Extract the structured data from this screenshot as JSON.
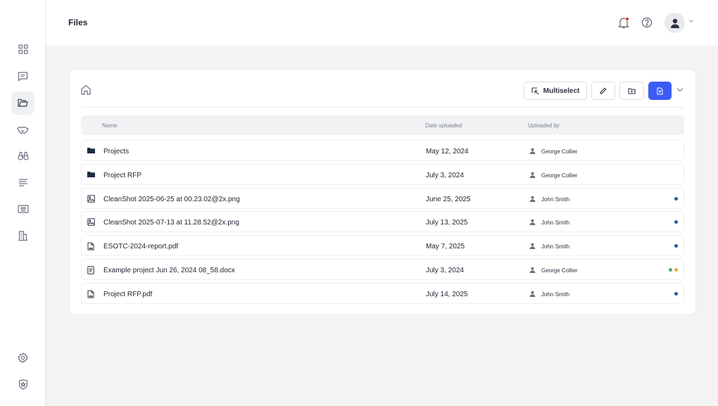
{
  "header": {
    "title": "Files",
    "notification_icon": "bell-icon",
    "help_icon": "help-circle-icon",
    "avatar_icon": "user-icon"
  },
  "sidebar": {
    "items": [
      {
        "icon": "dashboard-icon"
      },
      {
        "icon": "chat-icon"
      },
      {
        "icon": "folder-icon",
        "active": true
      },
      {
        "icon": "handshake-icon"
      },
      {
        "icon": "binoculars-icon"
      },
      {
        "icon": "text-lines-icon"
      },
      {
        "icon": "keyboard-icon"
      },
      {
        "icon": "building-icon"
      }
    ],
    "bottom_items": [
      {
        "icon": "settings-icon"
      },
      {
        "icon": "shield-icon"
      }
    ]
  },
  "toolbar": {
    "multiselect_label": "Multiselect"
  },
  "table": {
    "columns": [
      "Name",
      "Date uploaded",
      "Uploaded by"
    ],
    "rows": [
      {
        "type": "folder",
        "name": "Projects",
        "date": "May 12, 2024",
        "user": "George Collier",
        "status": []
      },
      {
        "type": "folder",
        "name": "Project RFP",
        "date": "July 3, 2024",
        "user": "George Collier",
        "status": []
      },
      {
        "type": "image",
        "name": "CleanShot 2025-06-25 at 00.23.02@2x.png",
        "date": "June 25, 2025",
        "user": "John Smith",
        "status": [
          "#2e5aa8"
        ]
      },
      {
        "type": "image",
        "name": "CleanShot 2025-07-13 at 11.28.52@2x.png",
        "date": "July 13, 2025",
        "user": "John Smith",
        "status": [
          "#2e5aa8"
        ]
      },
      {
        "type": "pdf",
        "name": "ESOTC-2024-report.pdf",
        "date": "May 7, 2025",
        "user": "John Smith",
        "status": [
          "#2e5aa8"
        ]
      },
      {
        "type": "doc",
        "name": "Example project Jun 26, 2024 08_58.docx",
        "date": "July 3, 2024",
        "user": "George Collier",
        "status": [
          "#3cb46b",
          "#f0a830"
        ]
      },
      {
        "type": "pdf",
        "name": "Project RFP.pdf",
        "date": "July 14, 2025",
        "user": "John Smith",
        "status": [
          "#2e5aa8"
        ]
      }
    ]
  },
  "colors": {
    "accent": "#3b5bf5",
    "notification_dot": "#d92b2b"
  }
}
